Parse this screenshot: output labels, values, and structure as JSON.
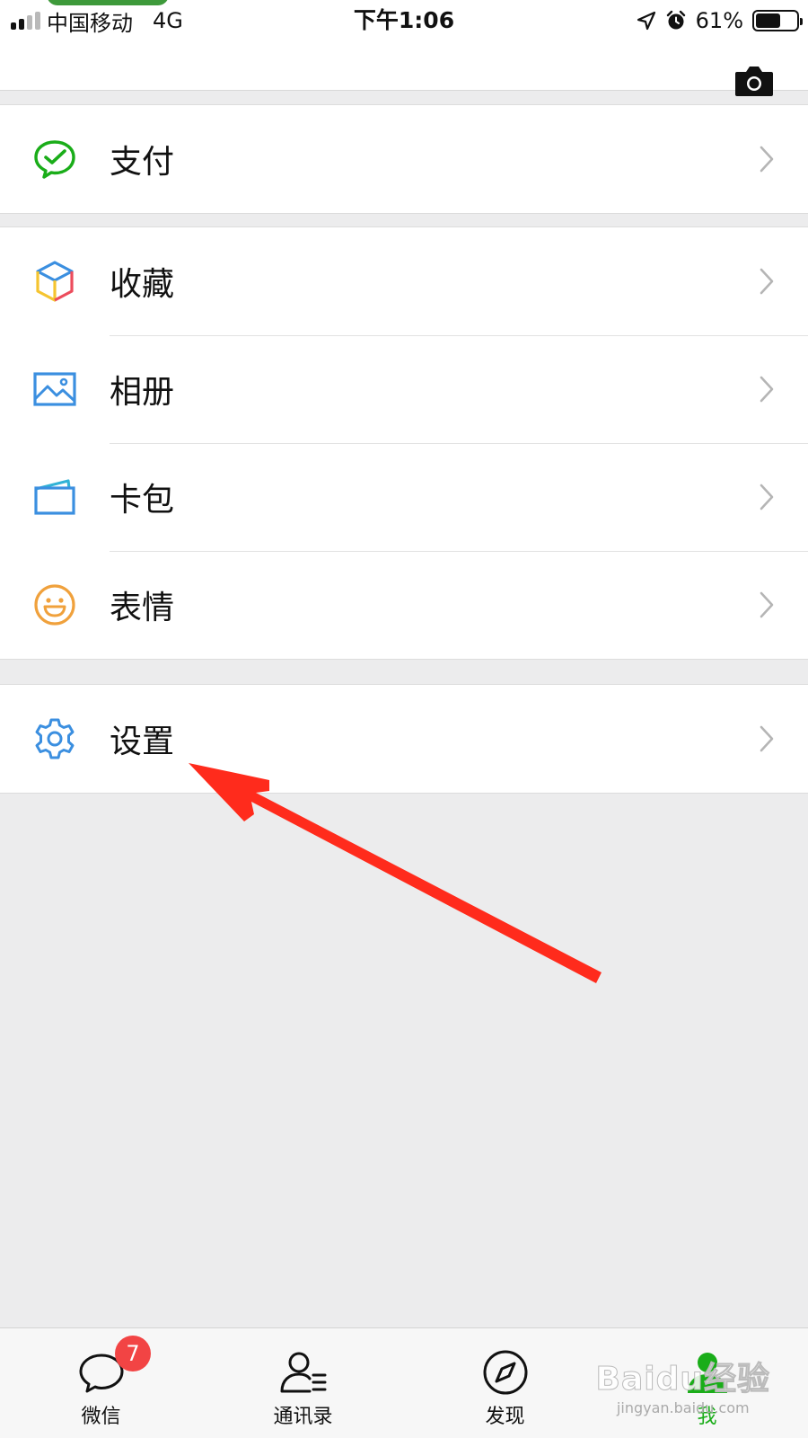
{
  "status_bar": {
    "carrier": "中国移动",
    "network": "4G",
    "time": "下午1:06",
    "battery_percent": "61%",
    "battery_level": 0.61,
    "icons": [
      "signal-icon",
      "location-arrow-icon",
      "alarm-clock-icon",
      "battery-icon"
    ]
  },
  "header": {
    "camera_icon": "camera-icon"
  },
  "menu": {
    "groups": [
      {
        "items": [
          {
            "label": "支付",
            "icon": "wechat-pay-icon"
          }
        ]
      },
      {
        "items": [
          {
            "label": "收藏",
            "icon": "favorites-cube-icon"
          },
          {
            "label": "相册",
            "icon": "album-photo-icon"
          },
          {
            "label": "卡包",
            "icon": "card-wallet-icon"
          },
          {
            "label": "表情",
            "icon": "sticker-smiley-icon"
          }
        ]
      },
      {
        "items": [
          {
            "label": "设置",
            "icon": "settings-gear-icon"
          }
        ]
      }
    ]
  },
  "annotation": {
    "icon": "red-arrow-pointer",
    "color": "#ff2b1c"
  },
  "tabbar": {
    "tabs": [
      {
        "label": "微信",
        "icon": "chat-bubble-icon",
        "badge": "7"
      },
      {
        "label": "通讯录",
        "icon": "contacts-icon"
      },
      {
        "label": "发现",
        "icon": "compass-icon"
      },
      {
        "label": "我",
        "icon": "me-person-icon",
        "active": true
      }
    ],
    "active_color": "#1aad19"
  },
  "watermark": {
    "text": "Baidu经验",
    "sub": "jingyan.baidu.com"
  },
  "colors": {
    "background": "#ececed",
    "accent_green": "#1aad19",
    "badge_red": "#f24444"
  }
}
